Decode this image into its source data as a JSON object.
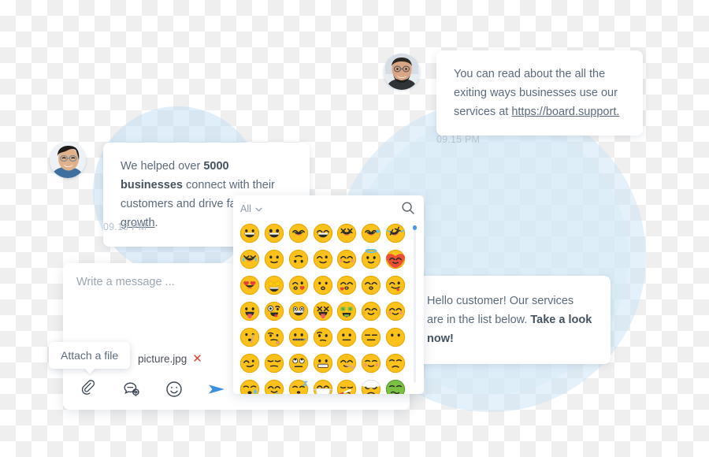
{
  "messages": [
    {
      "id": "msg-agent-1",
      "side": "right",
      "text_before": "You can read about the all the exiting ways businesses use our services at ",
      "link": "https://board.support.",
      "timestamp": "09.15 PM",
      "avatar": "agent-avatar"
    },
    {
      "id": "msg-agent-2",
      "side": "left",
      "text_start": "We helped over ",
      "text_bold": "5000 businesses",
      "text_mid": " connect with their customers and drive faster ",
      "text_link": "growth",
      "text_end": ".",
      "timestamp": "09.15 PM",
      "avatar": "user-avatar"
    },
    {
      "id": "msg-agent-3",
      "side": "right",
      "text_start": "Hello customer! Our services are in the list below. ",
      "text_bold": "Take a look now!"
    }
  ],
  "composer": {
    "placeholder": "Write a message ...",
    "attachment": {
      "filename": "picture.jpg",
      "remove_label": "✕"
    },
    "tooltip": "Attach a file",
    "toolbar": [
      {
        "name": "attach-file-button",
        "icon": "paperclip-icon",
        "label": "Attach a file"
      },
      {
        "name": "saved-replies-button",
        "icon": "chat-gear-icon",
        "label": "Saved replies"
      },
      {
        "name": "emoji-button",
        "icon": "smiley-icon",
        "label": "Emoji"
      },
      {
        "name": "send-button",
        "icon": "send-arrow-icon",
        "label": "Send"
      }
    ]
  },
  "emoji_picker": {
    "category": "All",
    "category_caret": "⌄",
    "search_icon": "search-icon",
    "rows": [
      [
        "grinning",
        "grinning-big-eyes",
        "beaming",
        "grin-smiling-eyes",
        "squinting-laugh",
        "sweat-smile",
        "rofl"
      ],
      [
        "joy-tears",
        "slight-smile",
        "upside-down",
        "wink",
        "smiling-blush",
        "halo",
        "heart-face"
      ],
      [
        "heart-eyes",
        "star-struck",
        "blowing-kiss",
        "kissing",
        "kissing-heart",
        "kissing-smile",
        "yum"
      ],
      [
        "tongue-out",
        "zany",
        "drooling-grin",
        "squint-tongue",
        "money-mouth",
        "hugging",
        "shush-smile"
      ],
      [
        "shushing",
        "thinking",
        "zipper-mouth",
        "raised-eyebrow",
        "neutral",
        "expressionless",
        "no-mouth"
      ],
      [
        "smirk",
        "unamused",
        "rolling-eyes",
        "grimacing",
        "lying",
        "relieved",
        "pensive"
      ],
      [
        "sad-relieved",
        "sleepy-drool",
        "sleeping",
        "mask",
        "thermometer-face",
        "bandage-head",
        "nauseated"
      ]
    ]
  },
  "colors": {
    "accent": "#3b8fe0",
    "bubble_text": "#5b6b7c",
    "timestamp": "#b7c2cd",
    "circle_blue": "#c4dff5",
    "close_red": "#e8413a",
    "emoji_yellow": "#fcc21b"
  }
}
